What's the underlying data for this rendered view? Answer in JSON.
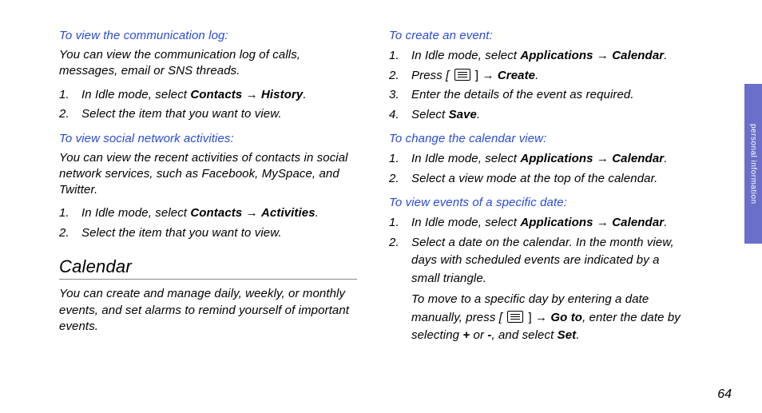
{
  "side_tab": "personal information",
  "page_number": "64",
  "left": {
    "h1": "To view the communication log:",
    "p1": "You can view the communication log of calls, messages, email or SNS threads.",
    "s1_pre": "In Idle mode, select ",
    "s1_b1": "Contacts",
    "s1_arrow": " → ",
    "s1_b2": "History",
    "s1_post": ".",
    "s2": "Select the item that you want to view.",
    "h2": "To view social network activities:",
    "p2": "You can view the recent activities of contacts in social network services, such as Facebook, MySpace, and Twitter.",
    "s3_pre": "In Idle mode, select ",
    "s3_b1": "Contacts",
    "s3_arrow": " → ",
    "s3_b2": "Activities",
    "s3_post": ".",
    "s4": "Select the item that you want to view.",
    "title": "Calendar",
    "p3": "You can create and manage daily, weekly, or monthly events, and set alarms to remind yourself of important events."
  },
  "right": {
    "h1": "To create an event:",
    "r1_pre": "In Idle mode, select ",
    "r1_b1": "Applications",
    "r1_arrow": " → ",
    "r1_b2": "Calendar",
    "r1_post": ".",
    "r2_pre": "Press [ ",
    "r2_mid": " ] → ",
    "r2_b": "Create",
    "r2_post": ".",
    "r3": "Enter the details of the event as required.",
    "r4_pre": "Select ",
    "r4_b": "Save",
    "r4_post": ".",
    "h2": "To change the calendar view:",
    "r5_pre": "In Idle mode, select ",
    "r5_b1": "Applications",
    "r5_arrow": " → ",
    "r5_b2": "Calendar",
    "r5_post": ".",
    "r6": "Select a view mode at the top of the calendar.",
    "h3": "To view events of a specific date:",
    "r7_pre": "In Idle mode, select ",
    "r7_b1": "Applications",
    "r7_arrow": " → ",
    "r7_b2": "Calendar",
    "r7_post": ".",
    "r8a": "Select a date on the calendar. In the month view, days with scheduled events are indicated by a small triangle.",
    "r8b_pre": "To move to a specific day by entering a date manually, press [ ",
    "r8b_mid": " ] → ",
    "r8b_b1": "Go to",
    "r8b_mid2": ", enter the date by selecting ",
    "r8b_b2": "+",
    "r8b_mid3": " or ",
    "r8b_b3": "-",
    "r8b_mid4": ", and select ",
    "r8b_b4": "Set",
    "r8b_post": "."
  }
}
